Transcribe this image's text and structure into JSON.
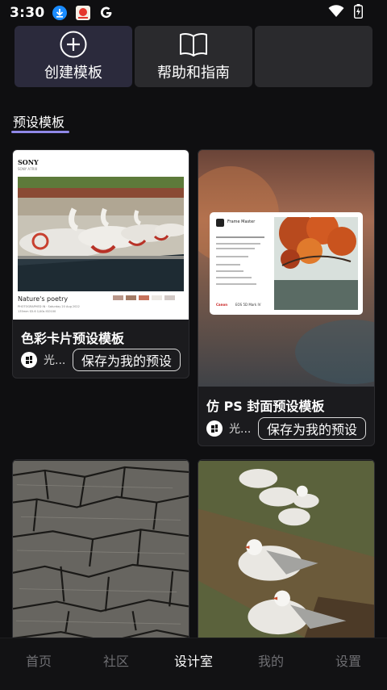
{
  "status_bar": {
    "time": "3:30",
    "icons": [
      "download-icon",
      "app-notification-icon",
      "google-icon"
    ],
    "right_icons": [
      "wifi-icon",
      "battery-icon"
    ]
  },
  "actions": [
    {
      "label": "创建模板",
      "icon": "plus-circle-icon"
    },
    {
      "label": "帮助和指南",
      "icon": "book-icon"
    },
    {
      "label": "",
      "icon": ""
    }
  ],
  "section": {
    "tab_label": "预设模板"
  },
  "templates": [
    {
      "title": "色彩卡片预设模板",
      "author": "光...",
      "save_label": "保存为我的预设",
      "preview": {
        "brand": "SONY",
        "model": "SONY A7RIII",
        "caption": "Nature's poetry",
        "meta": "PHOTOGRAPHED IN · Saturday 20 Aug 2022",
        "settings": "135mm  f/5.6  1/40s  ISO100"
      }
    },
    {
      "title": "仿 PS 封面预设模板",
      "author": "光...",
      "save_label": "保存为我的预设",
      "preview": {
        "app_name": "Frame Master",
        "camera": "Canon",
        "camera_model": "EOS 5D Mark IV"
      }
    },
    {
      "title": "",
      "author": "",
      "save_label": ""
    },
    {
      "title": "",
      "author": "",
      "save_label": ""
    }
  ],
  "colors": {
    "accent": "#8f88e8",
    "background": "#0f0f11",
    "card": "#1b1b1e"
  },
  "bottom_nav": [
    {
      "label": "首页",
      "active": false
    },
    {
      "label": "社区",
      "active": false
    },
    {
      "label": "设计室",
      "active": true
    },
    {
      "label": "我的",
      "active": false
    },
    {
      "label": "设置",
      "active": false
    }
  ]
}
